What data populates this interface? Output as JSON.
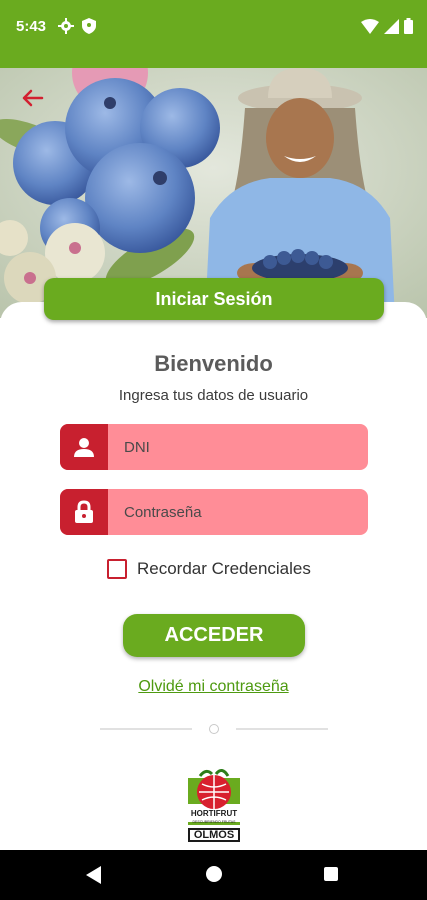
{
  "status_bar": {
    "time": "5:43",
    "icons": [
      "gear-icon",
      "shield-icon",
      "wifi-icon",
      "signal-icon",
      "battery-icon"
    ],
    "background": "#6aab1f"
  },
  "hero": {
    "description_icon": "hero-photo",
    "back_icon": "back-arrow-icon"
  },
  "login": {
    "banner_title": "Iniciar Sesión",
    "welcome": "Bienvenido",
    "subtitle": "Ingresa tus datos de usuario",
    "dni_placeholder": "DNI",
    "password_placeholder": "Contraseña",
    "remember_label": "Recordar Credenciales",
    "remember_checked": false,
    "submit_label": "ACCEDER",
    "forgot_label": "Olvidé mi contraseña"
  },
  "logo": {
    "brand": "HORTIFRUT",
    "tagline": "DESCUBRIENDO FRUTAS",
    "location": "OLMOS"
  },
  "colors": {
    "primary_green": "#6aab1f",
    "field_pink": "#ff8d97",
    "icon_red": "#c8202f",
    "link_green": "#4e9a10"
  },
  "nav_bar": {
    "icons": [
      "nav-back-icon",
      "nav-home-icon",
      "nav-recents-icon"
    ]
  }
}
